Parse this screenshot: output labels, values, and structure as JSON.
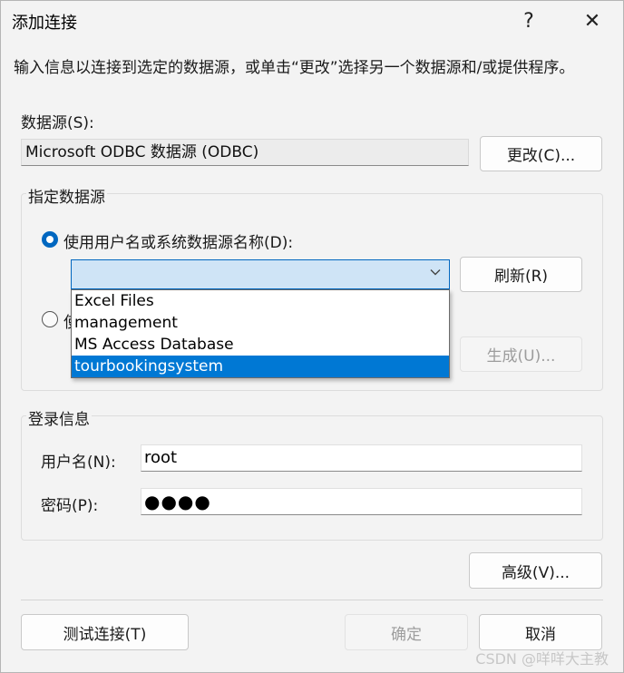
{
  "window": {
    "title": "添加连接",
    "help_glyph": "?",
    "close_glyph": "✕"
  },
  "description": "输入信息以连接到选定的数据源，或单击“更改”选择另一个数据源和/或提供程序。",
  "datasource": {
    "label": "数据源(S):",
    "value": "Microsoft ODBC 数据源 (ODBC)",
    "change_button": "更改(C)..."
  },
  "specify_group": {
    "title": "指定数据源",
    "radio_user_dsn": "使用用户名或系统数据源名称(D):",
    "radio_conn_string_partial": "使",
    "combo_value": "",
    "refresh_button": "刷新(R)",
    "build_button": "生成(U)...",
    "dropdown_options": [
      "Excel Files",
      "management",
      "MS Access Database",
      "tourbookingsystem"
    ],
    "selected_option": "tourbookingsystem"
  },
  "login_group": {
    "title": "登录信息",
    "username_label": "用户名(N):",
    "username_value": "root",
    "password_label": "密码(P):",
    "password_value": "●●●●"
  },
  "buttons": {
    "advanced": "高级(V)...",
    "test": "测试连接(T)",
    "ok": "确定",
    "cancel": "取消"
  },
  "watermark": "CSDN @咩咩大主教",
  "colors": {
    "accent": "#0067c0",
    "selection": "#0078d4",
    "combo_bg": "#cfe4f6"
  }
}
